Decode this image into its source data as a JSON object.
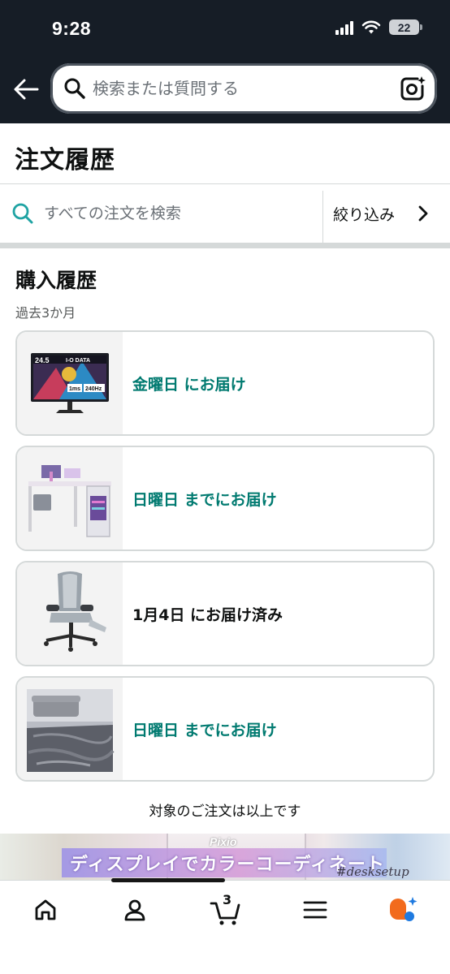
{
  "status_bar": {
    "time": "9:28",
    "battery": "22"
  },
  "header": {
    "search_placeholder": "検索または質問する"
  },
  "page": {
    "title": "注文履歴"
  },
  "order_search": {
    "placeholder": "すべての注文を検索",
    "filter_label": "絞り込み"
  },
  "purchase_history": {
    "title": "購入履歴",
    "subtitle": "過去3か月",
    "orders": [
      {
        "delivery": "金曜日 にお届け",
        "status_color": "#007a70",
        "thumb_text": {
          "size": "24.5",
          "brand": "I-O DATA",
          "tag1": "1ms",
          "tag2": "240Hz"
        }
      },
      {
        "delivery": "日曜日 までにお届け",
        "status_color": "#007a70"
      },
      {
        "delivery": "1月4日 にお届け済み",
        "status_color": "#0f1111"
      },
      {
        "delivery": "日曜日 までにお届け",
        "status_color": "#007a70"
      }
    ],
    "end_note": "対象のご注文は以上です"
  },
  "banner": {
    "brand": "Pixio",
    "text": "ディスプレイでカラーコーディネート",
    "hashtag": "#desksetup"
  },
  "bottom_nav": {
    "cart_count": "3"
  },
  "colors": {
    "header_bg": "#161d26",
    "accent_teal": "#007a70",
    "search_teal": "#1fa3a3",
    "divider": "#d5d9d9"
  }
}
